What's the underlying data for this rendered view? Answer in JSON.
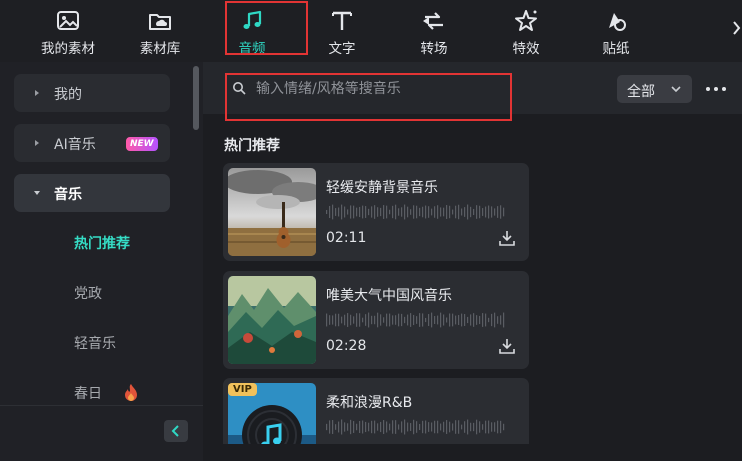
{
  "tabs": [
    {
      "label": "我的素材",
      "icon": "my-assets-icon"
    },
    {
      "label": "素材库",
      "icon": "library-icon"
    },
    {
      "label": "音频",
      "icon": "music-note-icon",
      "active": true
    },
    {
      "label": "文字",
      "icon": "text-icon"
    },
    {
      "label": "转场",
      "icon": "transition-icon"
    },
    {
      "label": "特效",
      "icon": "effects-icon"
    },
    {
      "label": "贴纸",
      "icon": "sticker-icon"
    }
  ],
  "sidebar": {
    "items": [
      {
        "label": "我的",
        "expanded": false
      },
      {
        "label": "AI音乐",
        "badge": "NEW",
        "expanded": false
      },
      {
        "label": "音乐",
        "expanded": true
      }
    ],
    "subitems": [
      {
        "label": "热门推荐",
        "active": true
      },
      {
        "label": "党政"
      },
      {
        "label": "轻音乐"
      },
      {
        "label": "春日",
        "icon": "fire-icon"
      }
    ]
  },
  "search": {
    "placeholder": "输入情绪/风格等搜音乐",
    "value": ""
  },
  "filter": {
    "selected": "全部"
  },
  "section": {
    "title": "热门推荐"
  },
  "tracks": [
    {
      "title": "轻缓安静背景音乐",
      "duration": "02:11"
    },
    {
      "title": "唯美大气中国风音乐",
      "duration": "02:28"
    },
    {
      "title": "柔和浪漫R&B",
      "badge": "VIP"
    }
  ],
  "colors": {
    "accent": "#2fd8c4",
    "highlight_box": "#e23434",
    "vip": "#f1c15b"
  }
}
